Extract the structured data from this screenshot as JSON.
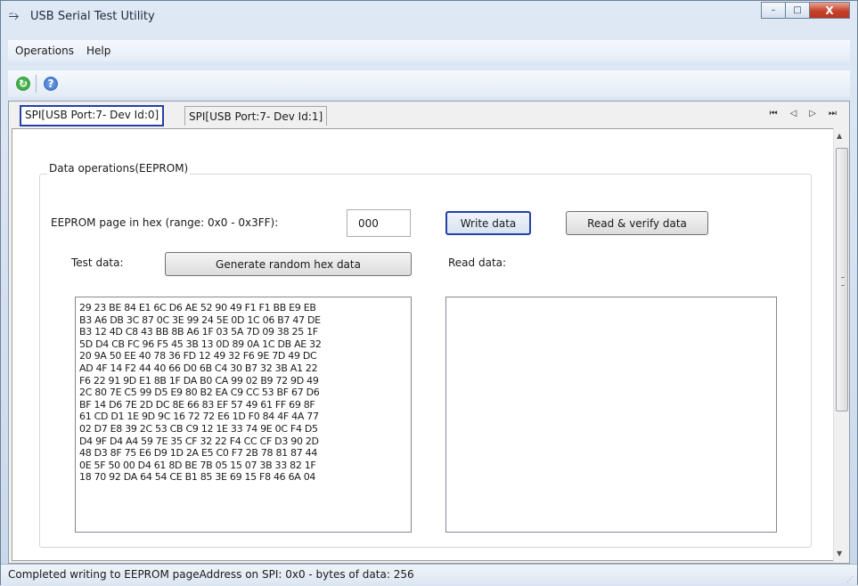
{
  "window": {
    "title": "USB Serial Test Utility",
    "app_icon": "usb-icon",
    "controls": {
      "minimize": "–",
      "maximize": "□",
      "close": "X"
    }
  },
  "menu": {
    "items": [
      "Operations",
      "Help"
    ]
  },
  "toolbar": {
    "icons": [
      "refresh-icon",
      "help-icon"
    ]
  },
  "tabs": {
    "items": [
      {
        "label": "SPI[USB Port:7- Dev Id:0]",
        "active": true
      },
      {
        "label": "SPI[USB Port:7- Dev Id:1]",
        "active": false
      }
    ],
    "nav": [
      "⏮",
      "◁",
      "▷",
      "⏭"
    ]
  },
  "panel": {
    "group_label": "Data operations(EEPROM)",
    "page_label": "EEPROM page in hex (range: 0x0 - 0x3FF):",
    "page_value": "000",
    "write_button": "Write data",
    "read_verify_button": "Read & verify data",
    "test_data_label": "Test data:",
    "generate_button": "Generate random hex data",
    "read_data_label": "Read data:",
    "test_data_lines": [
      "29 23 BE 84 E1 6C D6 AE 52 90 49 F1 F1 BB E9 EB",
      "B3 A6 DB 3C 87 0C 3E 99 24 5E 0D 1C 06 B7 47 DE",
      "B3 12 4D C8 43 BB 8B A6 1F 03 5A 7D 09 38 25 1F",
      "5D D4 CB FC 96 F5 45 3B 13 0D 89 0A 1C DB AE 32",
      "20 9A 50 EE 40 78 36 FD 12 49 32 F6 9E 7D 49 DC",
      "AD 4F 14 F2 44 40 66 D0 6B C4 30 B7 32 3B A1 22",
      "F6 22 91 9D E1 8B 1F DA B0 CA 99 02 B9 72 9D 49",
      "2C 80 7E C5 99 D5 E9 80 B2 EA C9 CC 53 BF 67 D6",
      "BF 14 D6 7E 2D DC 8E 66 83 EF 57 49 61 FF 69 8F",
      "61 CD D1 1E 9D 9C 16 72 72 E6 1D F0 84 4F 4A 77",
      "02 D7 E8 39 2C 53 CB C9 12 1E 33 74 9E 0C F4 D5",
      "D4 9F D4 A4 59 7E 35 CF 32 22 F4 CC CF D3 90 2D",
      "48 D3 8F 75 E6 D9 1D 2A E5 C0 F7 2B 78 81 87 44",
      "0E 5F 50 00 D4 61 8D BE 7B 05 15 07 3B 33 82 1F",
      "18 70 92 DA 64 54 CE B1 85 3E 69 15 F8 46 6A 04"
    ],
    "read_data_value": ""
  },
  "status": {
    "text": "Completed writing to EEPROM pageAddress on SPI: 0x0 - bytes of data: 256"
  }
}
